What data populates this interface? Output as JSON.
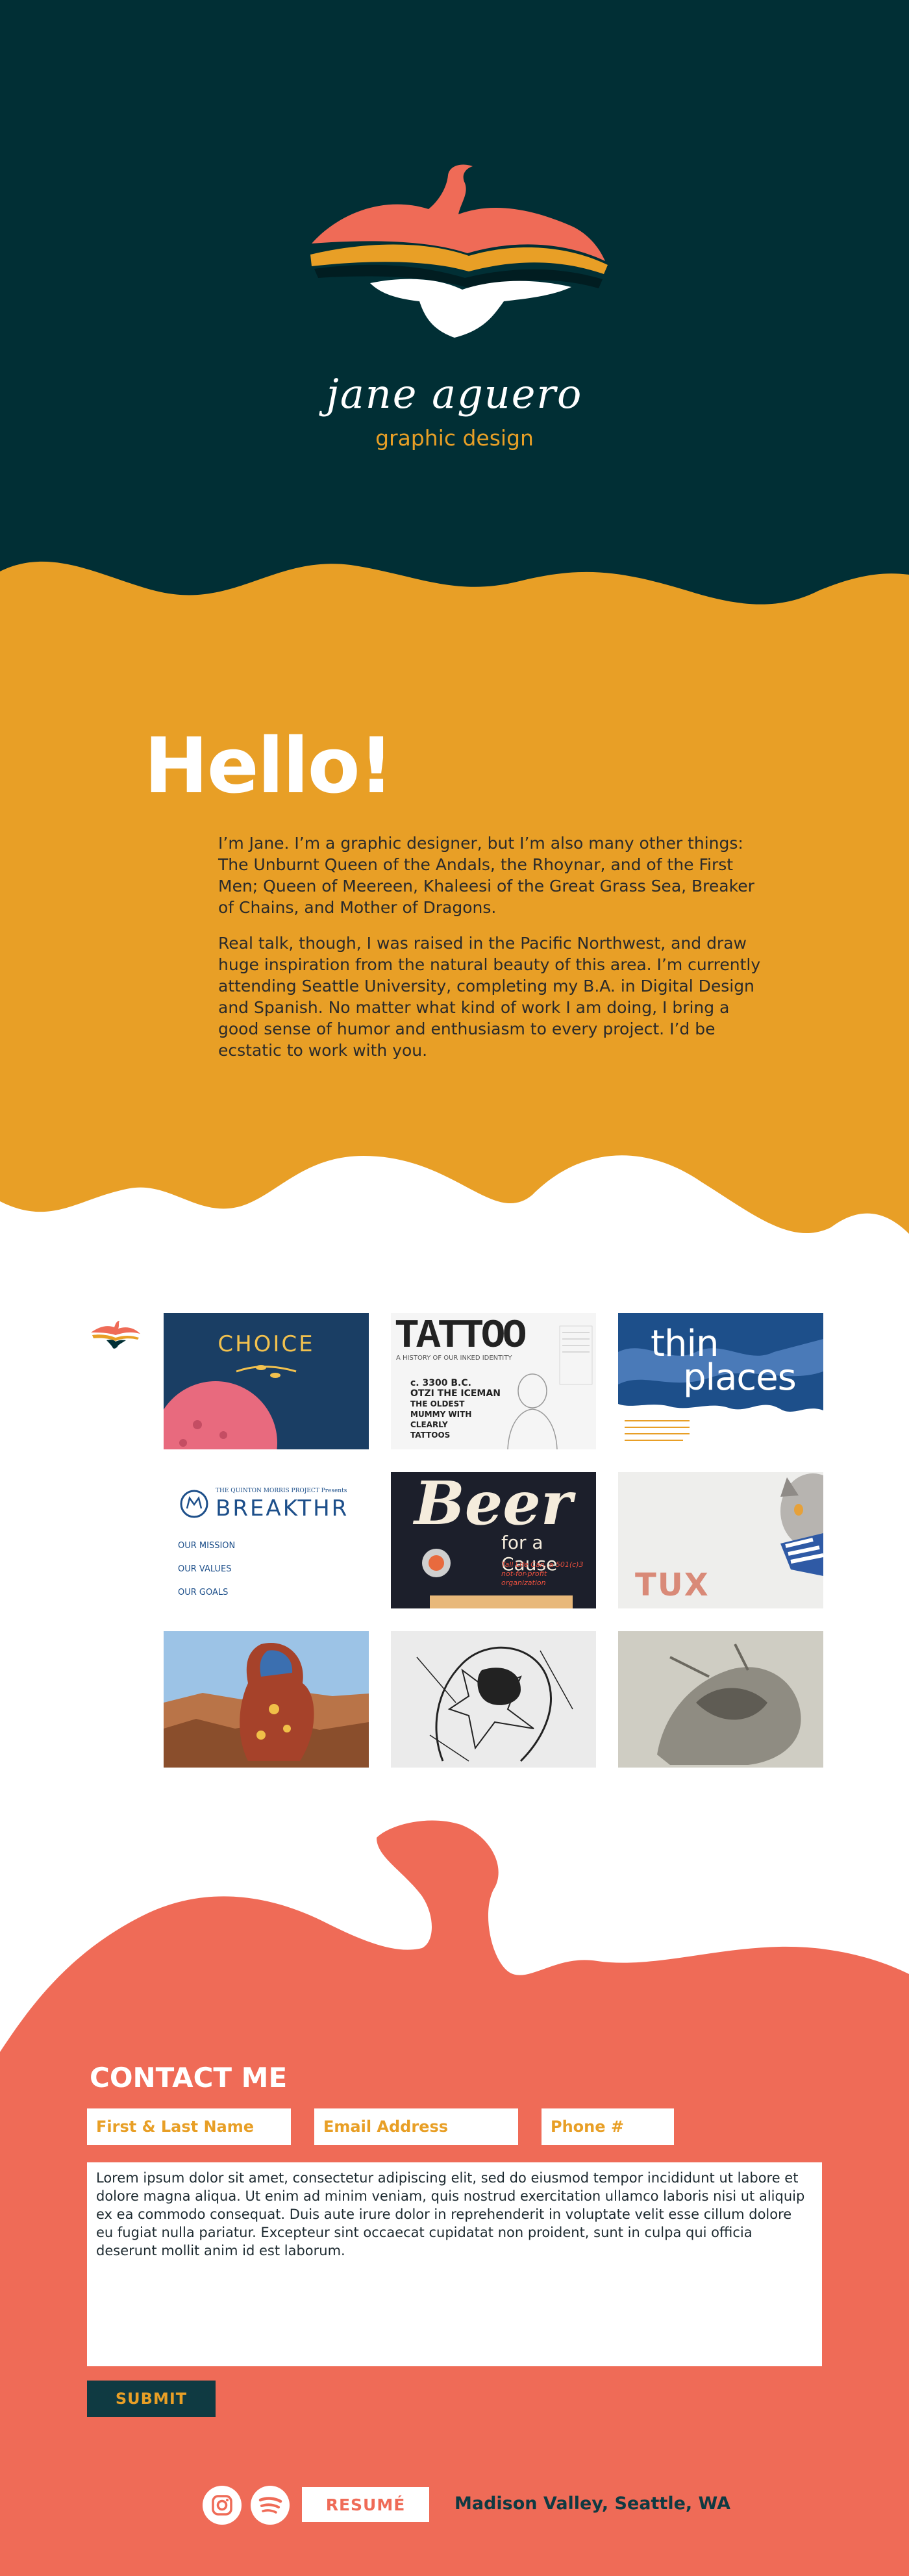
{
  "header": {
    "name": "jane aguero",
    "tagline": "graphic design"
  },
  "about": {
    "heading": "Hello!",
    "paragraph_1": "I’m Jane. I’m a graphic designer, but I’m also many other things: The Unburnt Queen of the Andals, the Rhoynar, and of the First Men; Queen of Meereen, Khaleesi of the Great Grass Sea, Breaker of Chains, and Mother of Dragons.",
    "paragraph_2": "Real talk, though, I was raised in the Pacific Northwest, and draw huge inspiration from the natural beauty of this area. I’m currently attending Seattle University, completing my B.A. in Digital Design and Spanish. No matter what kind of work I am doing, I bring a good sense of humor and enthusiasm to every project. I’d be ecstatic to work with you."
  },
  "portfolio": {
    "choice": {
      "title": "CHOICE"
    },
    "tattoo": {
      "title": "TATTOO",
      "subtitle": "A HISTORY OF OUR INKED IDENTITY",
      "lines": [
        "c. 3300 B.C.",
        "OTZI THE ICEMAN",
        "THE OLDEST",
        "MUMMY WITH",
        "CLEARLY",
        "TATTOOS"
      ]
    },
    "thin_places": {
      "title_1": "thin",
      "title_2": "places"
    },
    "breakthr": {
      "presenter": "THE QUINTON MORRIS PROJECT Presents",
      "title": "BREAKTHR",
      "headings": [
        "OUR MISSION",
        "OUR VALUES",
        "OUR GOALS"
      ]
    },
    "beer": {
      "title": "Beer",
      "subtitle": "for a Cause",
      "tagline": "Tall Life Can, a 501(c)3 not-for-profit organization"
    },
    "tux": {
      "title": "TUX"
    }
  },
  "contact": {
    "heading": "CONTACT ME",
    "name_placeholder": "First & Last Name",
    "email_placeholder": "Email Address",
    "phone_placeholder": "Phone #",
    "message": "Lorem ipsum dolor sit amet, consectetur adipiscing elit, sed do eiusmod tempor incididunt ut labore et dolore magna aliqua. Ut enim ad minim veniam, quis nostrud exercitation ullamco laboris nisi ut aliquip ex ea commodo consequat. Duis aute irure dolor in reprehenderit in voluptate velit esse cillum dolore eu fugiat nulla pariatur. Excepteur sint occaecat cupidatat non proident, sunt in culpa qui officia deserunt mollit anim id est laborum.",
    "submit_label": "SUBMIT"
  },
  "footer": {
    "instagram_icon": "instagram-icon",
    "spotify_icon": "spotify-icon",
    "resume_label": "RESUMÉ",
    "location": "Madison Valley, Seattle, WA"
  },
  "colors": {
    "dark_teal": "#012f35",
    "mustard": "#e89f26",
    "coral": "#ef6b57",
    "navy": "#0f3a42",
    "white": "#ffffff"
  }
}
